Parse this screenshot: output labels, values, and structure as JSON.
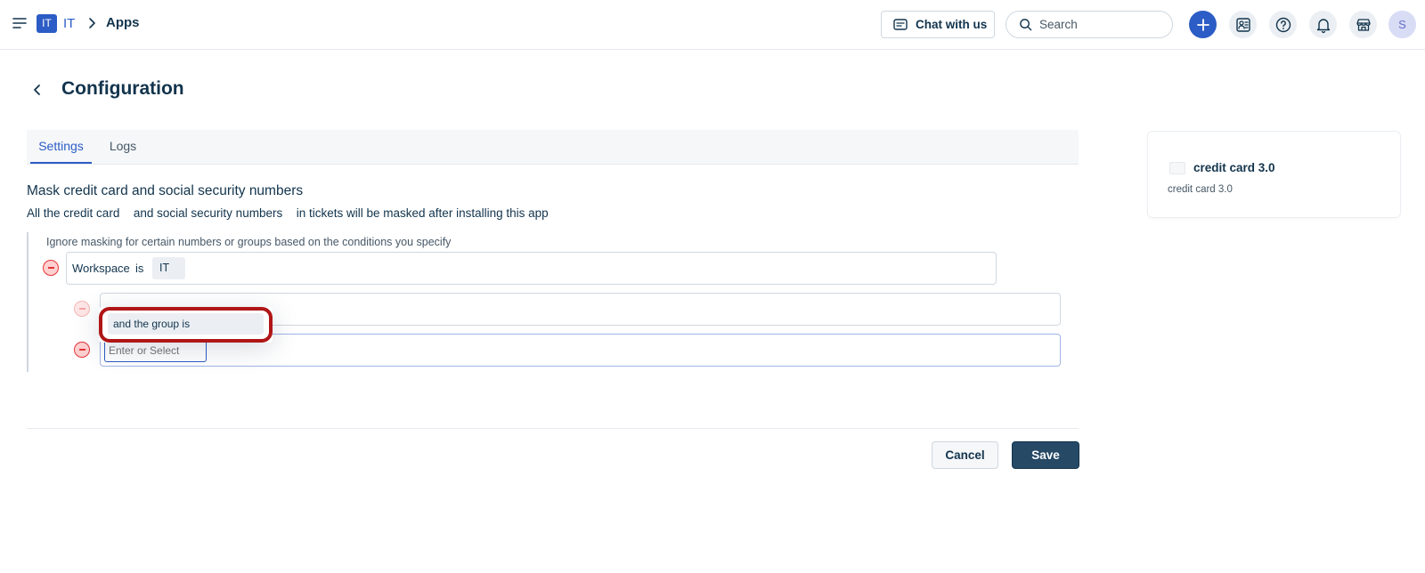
{
  "header": {
    "workspace_badge": "IT",
    "workspace_name": "IT",
    "breadcrumb_current": "Apps",
    "chat_label": "Chat with us",
    "search_placeholder": "Search",
    "avatar_initial": "S",
    "accent_color": "#2c5cc5"
  },
  "page": {
    "title": "Configuration",
    "tabs": [
      {
        "label": "Settings",
        "active": true
      },
      {
        "label": "Logs",
        "active": false
      }
    ]
  },
  "settings": {
    "section_title": "Mask credit card and social security numbers",
    "desc_prefix": "All the",
    "desc_credit_card": "credit card",
    "desc_and": "and",
    "desc_ssn": "social security numbers",
    "desc_suffix": "in tickets will be masked after installing this app",
    "conditions_note": "Ignore masking for certain numbers or groups based on the conditions you specify",
    "condition1": {
      "field": "Workspace",
      "operator": "is",
      "value": "IT"
    },
    "condition3_placeholder": "Enter or Select",
    "dropdown_option": "and the group is"
  },
  "footer": {
    "cancel_label": "Cancel",
    "save_label": "Save"
  },
  "sidebar_card": {
    "app_name": "credit card 3.0",
    "app_subtitle": "credit card 3.0"
  }
}
